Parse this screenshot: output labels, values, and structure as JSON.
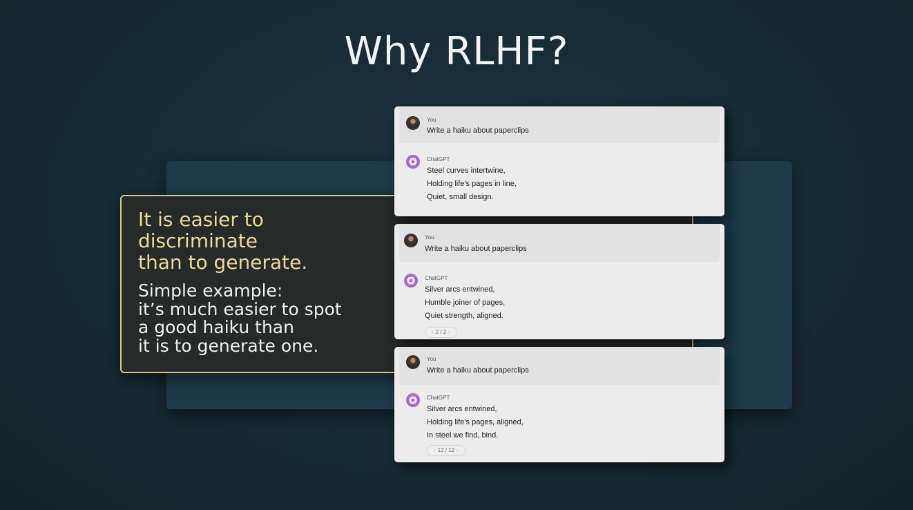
{
  "slide": {
    "title": "Why RLHF?"
  },
  "callout": {
    "heading_lines": [
      "It is easier to",
      "discriminate",
      "than to generate."
    ],
    "body_lines": [
      "Simple example:",
      "it’s much easier to spot",
      "a good haiku than",
      "it is to generate one."
    ]
  },
  "conversations": [
    {
      "user_name": "You",
      "user_message": "Write a haiku about paperclips",
      "assistant_name": "ChatGPT",
      "response_lines": [
        "Steel curves intertwine,",
        "Holding life's pages in line,",
        "Quiet, small design."
      ]
    },
    {
      "user_name": "You",
      "user_message": "Write a haiku about paperclips",
      "assistant_name": "ChatGPT",
      "response_lines": [
        "Silver arcs entwined,",
        "Humble joiner of pages,",
        "Quiet strength, aligned."
      ],
      "pager": "2 / 2"
    },
    {
      "user_name": "You",
      "user_message": "Write a haiku about paperclips",
      "assistant_name": "ChatGPT",
      "response_lines": [
        "Silver arcs entwined,",
        "Holding life's pages, aligned,",
        "In steel we find, bind."
      ],
      "pager": "12 / 12"
    }
  ],
  "icons": {
    "user": "user-avatar-icon",
    "assistant": "openai-logo-icon",
    "prev": "chevron-left-icon",
    "next": "chevron-right-icon"
  },
  "colors": {
    "background": "#162a32",
    "callout_border": "#d8c88e",
    "callout_heading": "#ecd99a",
    "assistant_icon": "#a26ad4"
  }
}
